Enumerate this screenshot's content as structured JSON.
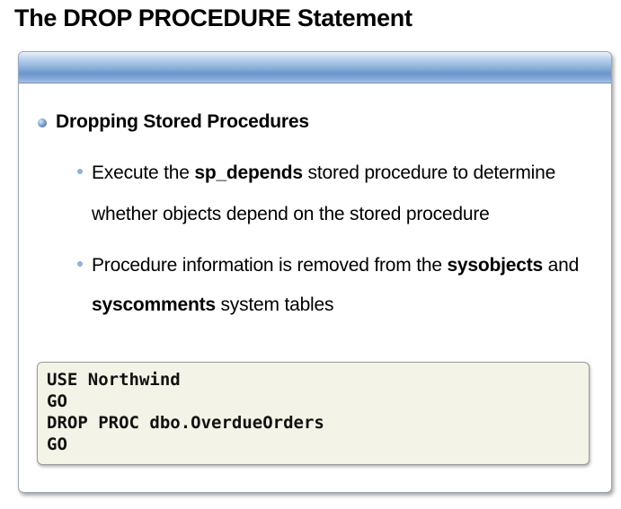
{
  "slide": {
    "title": "The DROP PROCEDURE Statement"
  },
  "bullets": {
    "main": "Dropping Stored Procedures",
    "sub1": {
      "pre": "Execute the ",
      "bold": "sp_depends",
      "post": " stored procedure to determine",
      "line2": "whether objects depend on the stored procedure"
    },
    "sub2": {
      "pre": "Procedure information is removed from the ",
      "bold1": "sysobjects",
      "post": " and",
      "bold2": "syscomments",
      "line2_post": " system tables"
    }
  },
  "code": {
    "lines": [
      "USE Northwind",
      "GO",
      "DROP PROC dbo.OverdueOrders",
      "GO"
    ]
  },
  "colors": {
    "header_gradient_mid": "#8eb2dc",
    "code_background": "#f3f3e7",
    "sub_bullet": "#8fb0d9"
  }
}
